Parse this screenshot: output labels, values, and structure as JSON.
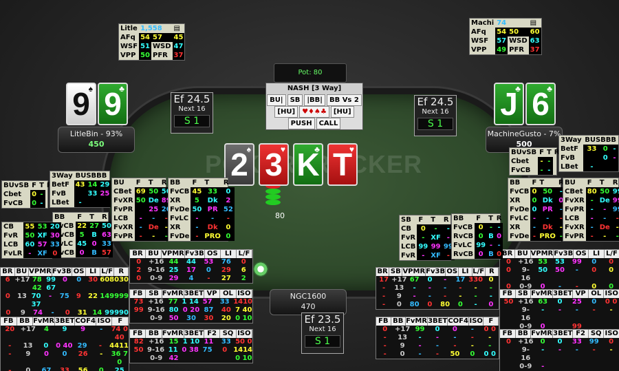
{
  "table": {
    "watermark": "POKERTRACKER",
    "pot_label": "Pot: 80",
    "bet_amount": "80"
  },
  "board": [
    {
      "rank": "2",
      "suit": "♠",
      "style": "s"
    },
    {
      "rank": "3",
      "suit": "♥",
      "style": "h"
    },
    {
      "rank": "K",
      "suit": "♣",
      "style": "c"
    },
    {
      "rank": "T",
      "suit": "♥",
      "style": "h"
    }
  ],
  "players": {
    "left": {
      "name": "LitleBin - 93%",
      "stack": "450",
      "cards": [
        {
          "rank": "9",
          "suit": "♠",
          "style": "w"
        },
        {
          "rank": "9",
          "suit": "♣",
          "style": "c"
        }
      ],
      "hud": {
        "name": "Litle",
        "hands": "1,558",
        "afq": "54",
        "afq2": "57",
        "afq3": "45",
        "wsf": "51",
        "wsd": "47",
        "vpp": "50",
        "pfr": "37"
      }
    },
    "right": {
      "name": "MachineGusto - 7%",
      "stack": "500",
      "cards": [
        {
          "rank": "J",
          "suit": "♣",
          "style": "c"
        },
        {
          "rank": "6",
          "suit": "♣",
          "style": "c"
        }
      ],
      "hud": {
        "name": "Machi",
        "hands": "74",
        "afq": "54",
        "afq2": "50",
        "afq3": "60",
        "wsf": "57",
        "wsd": "63",
        "vpp": "49",
        "pfr": "37"
      }
    },
    "hero": {
      "name": "NGC1600",
      "stack": "470"
    }
  },
  "ef_boxes": {
    "left": {
      "value": "Ef 24.5",
      "next": "Next 16",
      "s": "S 1"
    },
    "right": {
      "value": "Ef 24.5",
      "next": "Next 16",
      "s": "S 1"
    },
    "hero": {
      "value": "Ef 23.5",
      "next": "Next 16",
      "s": "S 1"
    }
  },
  "nash": {
    "title": "NASH [3 Way]",
    "pos": [
      "BU|",
      "SB",
      "|BB|",
      "BB Vs 2"
    ],
    "hu_left": "[HU]",
    "hu_right": "[HU]",
    "push": "PUSH",
    "call": "CALL"
  },
  "hud_labels": {
    "afq": "AFq",
    "wsf": "WSF",
    "wsd": "WSD",
    "vpp": "VPP",
    "pfr": "PFR"
  },
  "stat_tables": {
    "bl1": {
      "headers": [
        "BR",
        "BU",
        "VPMR",
        "Fv3B",
        "OS",
        "LI",
        "L/F",
        "R"
      ],
      "rows": [
        [
          "6",
          "+17",
          "78 42",
          "99 67",
          "0",
          "0",
          "30",
          "608030"
        ],
        [
          "0",
          "13",
          "70 37",
          "-",
          "75",
          "9",
          "22",
          "149999"
        ],
        [
          "0",
          "9",
          "74 29",
          "-",
          "0",
          "31",
          "14",
          "99990"
        ],
        [
          "0",
          "0",
          "65 6",
          "",
          "",
          "",
          "56",
          "4"
        ]
      ]
    },
    "bl2": {
      "headers": [
        "FB",
        "BB",
        "FvMR",
        "3BET",
        "COF4",
        "ISO",
        "F"
      ],
      "rows": [
        [
          "20",
          "+17",
          "4",
          "9",
          "9",
          "-",
          "74 0 40"
        ],
        [
          "-",
          "13",
          "0",
          "0 40",
          "29",
          "-",
          "4411"
        ],
        [
          "-",
          "9",
          "0",
          "0",
          "26",
          "-",
          "36 7 0"
        ],
        [
          "-",
          "0",
          "67",
          "33",
          "56",
          "0",
          "25"
        ]
      ]
    },
    "bc1": {
      "headers": [
        "BR",
        "BU",
        "VPMR",
        "Fv3B",
        "OS",
        "LI",
        "L/F"
      ],
      "rows": [
        [
          "0",
          "+16",
          "44",
          "44",
          "53",
          "76",
          "0"
        ],
        [
          "2",
          "9-16",
          "25",
          "17",
          "0",
          "29",
          "6"
        ],
        [
          "0",
          "0-9",
          "29",
          "4",
          "-",
          "27",
          "2"
        ]
      ]
    },
    "bc2": {
      "headers": [
        "FB",
        "SB",
        "FvMR",
        "3BET",
        "VP",
        "OL",
        "ISO"
      ],
      "rows": [
        [
          "73",
          "+16",
          "77",
          "1 14",
          "57",
          "33",
          "1410"
        ],
        [
          "99",
          "9-16",
          "80",
          "0 20",
          "87",
          "40",
          "7 40"
        ],
        [
          "",
          "0-9",
          "50",
          "30",
          "30",
          "20",
          "0 10"
        ]
      ]
    },
    "bc3": {
      "headers": [
        "FB",
        "BB",
        "FvMR",
        "3BET",
        "F2",
        "SQ",
        "ISO"
      ],
      "rows": [
        [
          "82",
          "+16",
          "15",
          "1 10",
          "11",
          "33",
          "50 0"
        ],
        [
          "50",
          "9-16",
          "11",
          "0 38",
          "75",
          "0",
          "1414"
        ],
        [
          "",
          "0-9",
          "42",
          "",
          "",
          "",
          "0 10"
        ]
      ]
    },
    "br1": {
      "headers": [
        "BR",
        "SB",
        "VPMR",
        "Fv3B",
        "OS",
        "LI",
        "L/F",
        "R"
      ],
      "rows": [
        [
          "17",
          "+17",
          "67",
          "0",
          "-",
          "17",
          "330",
          "0"
        ],
        [
          "-",
          "13",
          "-",
          "-",
          "-",
          "-",
          "-",
          "-"
        ],
        [
          "-",
          "9",
          "-",
          "-",
          "-",
          "-",
          "-",
          "-"
        ],
        [
          "-",
          "0",
          "80",
          "0",
          "80",
          "0",
          "-",
          "0"
        ]
      ]
    },
    "br2": {
      "headers": [
        "FB",
        "BB",
        "FvMR",
        "3BET",
        "COF4",
        "ISO",
        "F"
      ],
      "rows": [
        [
          "0",
          "+17",
          "99",
          "0",
          "0",
          "-",
          "0 0"
        ],
        [
          "-",
          "13",
          "-",
          "-",
          "-",
          "-",
          "-"
        ],
        [
          "-",
          "9",
          "-",
          "-",
          "-",
          "-",
          "-"
        ],
        [
          "-",
          "0",
          "-",
          "-",
          "50",
          "0",
          "0 0"
        ]
      ]
    },
    "rr1": {
      "headers": [
        "BR",
        "BU",
        "VPMR",
        "Fv3B",
        "OS",
        "LI",
        "L/F"
      ],
      "rows": [
        [
          "0",
          "+16",
          "53",
          "53",
          "99",
          "0",
          "0"
        ],
        [
          "0",
          "9-16",
          "50",
          "50",
          "-",
          "0",
          "0"
        ],
        [
          "0",
          "0-9",
          "0",
          "-",
          "-",
          "0",
          "0"
        ]
      ]
    },
    "rr2": {
      "headers": [
        "FB",
        "SB",
        "FvMR",
        "3BET",
        "VP",
        "OL",
        "ISO"
      ],
      "rows": [
        [
          "50",
          "+16",
          "63",
          "0",
          "25",
          "0",
          "0 0"
        ],
        [
          "",
          "9-16",
          "-",
          "-",
          "-",
          "-",
          "-"
        ],
        [
          "",
          "0-9",
          "0",
          "",
          "99",
          "",
          ""
        ]
      ]
    },
    "rr3": {
      "headers": [
        "FB",
        "BB",
        "FvMR",
        "3BET",
        "F2",
        "SQ",
        "ISO"
      ],
      "rows": [
        [
          "0",
          "+16",
          "0",
          "0",
          "33",
          "99",
          "0"
        ],
        [
          "",
          "9-16",
          "-",
          "-",
          "-",
          "-",
          "-"
        ],
        [
          "",
          "0-9",
          "-",
          "",
          "",
          "",
          ""
        ]
      ]
    }
  },
  "mini": {
    "lbuvsb": {
      "title": "BUvSB",
      "f": "F",
      "t": "T",
      "r": "R",
      "rows": [
        [
          "Cbet",
          "0",
          "-"
        ],
        [
          "FvCB",
          "0",
          "-"
        ]
      ]
    },
    "l3way": {
      "title": "3Way",
      "cols": "BUSBBB",
      "rows": [
        [
          "BetF",
          "43",
          "14",
          "29"
        ],
        [
          "FvB",
          "",
          "33",
          "25"
        ],
        [
          "LBet",
          "-",
          "",
          ""
        ]
      ]
    },
    "lbb": {
      "title": "BB",
      "f": "F",
      "t": "T",
      "r": "R",
      "rows": [
        [
          "FvCB",
          "22",
          "27",
          "50"
        ],
        [
          "RvCB",
          "5",
          "B",
          "63"
        ],
        [
          "FvLC",
          "45",
          "0",
          "33"
        ],
        [
          "RvCB",
          "0",
          "B",
          "57"
        ]
      ]
    },
    "lcb": {
      "rows": [
        [
          "CB",
          "55",
          "53",
          "20"
        ],
        [
          "FvR",
          "50",
          "XF",
          "30"
        ],
        [
          "LCB",
          "60",
          "57",
          "33"
        ],
        [
          "FvLR",
          "-",
          "XF",
          "0"
        ]
      ]
    },
    "lbu": {
      "title": "BU",
      "f": "F",
      "t": "T",
      "r": "R",
      "rows": [
        [
          "CBet",
          "69",
          "50",
          "50"
        ],
        [
          "FvXR",
          "50",
          "De",
          "89"
        ],
        [
          "FvPR",
          "",
          "25",
          "20"
        ],
        [
          "LCB",
          "-",
          "-",
          "-"
        ],
        [
          "FvXR",
          "-",
          "De",
          "-"
        ],
        [
          "FvPR",
          "-",
          "-",
          "-"
        ]
      ]
    },
    "lbb2": {
      "title": "BB",
      "f": "F",
      "t": "T",
      "r": "R",
      "rows": [
        [
          "FvCB",
          "45",
          "33",
          "0"
        ],
        [
          "XR",
          "5",
          "Dk",
          "2"
        ],
        [
          "FvDe",
          "50",
          "PR",
          "52"
        ],
        [
          "FvLC",
          "-",
          "-",
          "-"
        ],
        [
          "XR",
          "-",
          "Dk",
          "0"
        ],
        [
          "FvDe",
          "-",
          "PRO",
          "0"
        ]
      ]
    },
    "csb": {
      "title": "SB",
      "f": "F",
      "t": "T",
      "r": "R",
      "rows": [
        [
          "CB",
          "0",
          "-",
          "-"
        ],
        [
          "FvR",
          "-",
          "XF",
          "-"
        ],
        [
          "LCB",
          "99",
          "99",
          "99"
        ],
        [
          "FvR",
          "-",
          "XF",
          "-"
        ]
      ]
    },
    "cbb": {
      "title": "BB",
      "f": "F",
      "t": "T",
      "r": "R",
      "rows": [
        [
          "FvCB",
          "0",
          "-",
          "-"
        ],
        [
          "RvCB",
          "0",
          "B",
          "0"
        ],
        [
          "FvLC",
          "99",
          "-",
          "-"
        ],
        [
          "RvCB",
          "0",
          "B",
          "0"
        ]
      ]
    },
    "rbuvsb": {
      "title": "BUvSB",
      "f": "F",
      "t": "T",
      "r": "R",
      "rows": [
        [
          "Cbet",
          "-",
          "-"
        ],
        [
          "FvCB",
          "-",
          "-"
        ]
      ]
    },
    "r3way": {
      "title": "3Way",
      "cols": "BUSBBB",
      "rows": [
        [
          "BetF",
          "33",
          "0",
          "-"
        ],
        [
          "FvB",
          "",
          "0",
          "-"
        ],
        [
          "LBet",
          "-",
          "",
          ""
        ]
      ]
    },
    "rbb": {
      "title": "BB",
      "f": "F",
      "t": "T",
      "r": "R",
      "rows": [
        [
          "FvCB",
          "0",
          "50",
          "-"
        ],
        [
          "XR",
          "0",
          "Dk",
          "0"
        ],
        [
          "FvDe",
          "0",
          "PR",
          "-"
        ],
        [
          "FvLC",
          "-",
          "-",
          "-"
        ],
        [
          "XR",
          "-",
          "Dk",
          "-"
        ],
        [
          "FvDe",
          "-",
          "PRO",
          "-"
        ]
      ]
    },
    "rbu": {
      "title": "BU",
      "f": "F",
      "t": "T",
      "r": "R",
      "rows": [
        [
          "CBet",
          "80",
          "50",
          "99"
        ],
        [
          "FvXR",
          "-",
          "De",
          "99"
        ],
        [
          "FvPR",
          "-",
          "-",
          "99"
        ],
        [
          "LCB",
          "-",
          "-",
          "-"
        ],
        [
          "FvXR",
          "-",
          "De",
          "-"
        ],
        [
          "FvPR",
          "-",
          "-",
          "-"
        ]
      ]
    }
  }
}
